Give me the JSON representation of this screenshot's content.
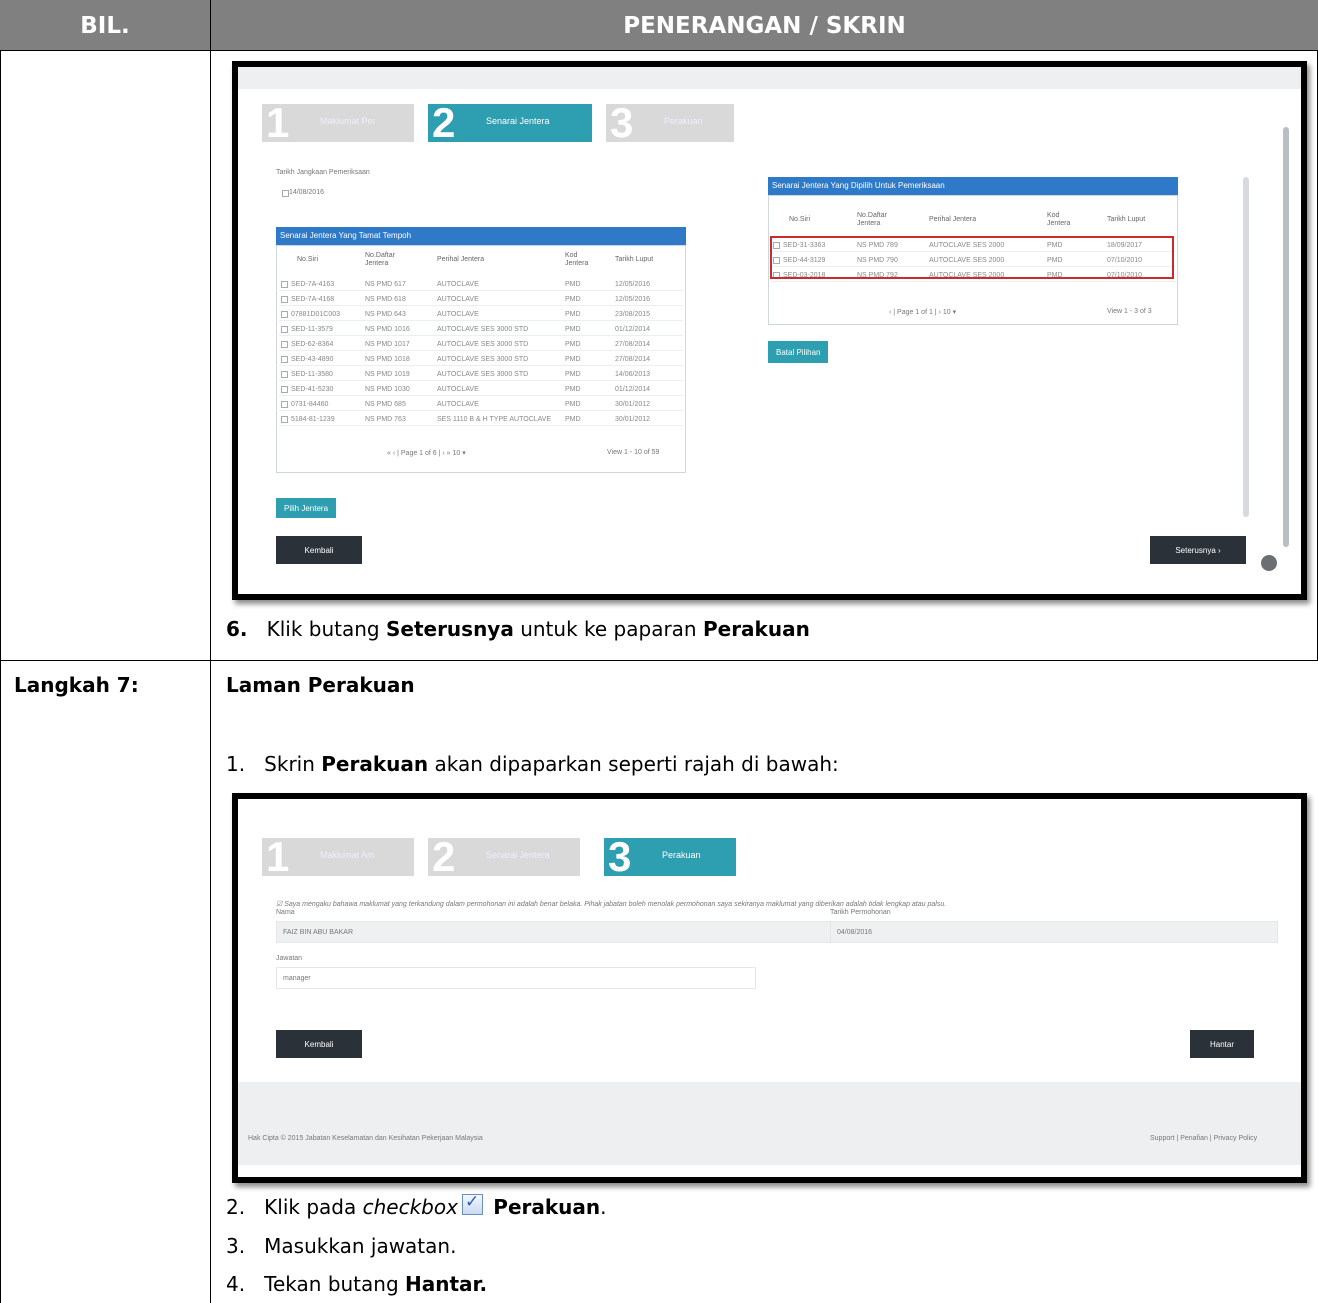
{
  "table": {
    "col1_header": "BIL.",
    "col2_header": "PENERANGAN / SKRIN"
  },
  "row1": {
    "instruction_num": "6.",
    "instruction_pre": "Klik butang ",
    "instruction_bold1": "Seterusnya",
    "instruction_mid": " untuk ke paparan ",
    "instruction_bold2": "Perakuan"
  },
  "row2": {
    "step_label": "Langkah 7:",
    "section_title": "Laman Perakuan",
    "item1_num": "1.",
    "item1_pre": "Skrin ",
    "item1_bold": "Perakuan",
    "item1_post": " akan dipaparkan seperti rajah di bawah:",
    "item2_num": "2.",
    "item2_pre": "Klik pada ",
    "item2_italic": "checkbox",
    "item2_bold": "Perakuan",
    "item2_post": ".",
    "item3_num": "3.",
    "item3_text": "Masukkan jawatan.",
    "item4_num": "4.",
    "item4_pre": "Tekan butang ",
    "item4_bold": "Hantar."
  },
  "shot1": {
    "steps": [
      {
        "n": "1",
        "label": "Maklumat Per"
      },
      {
        "n": "2",
        "label": "Senarai Jentera"
      },
      {
        "n": "3",
        "label": "Perakuan"
      }
    ],
    "date_label": "Tarikh Jangkaan Pemeriksaan",
    "date_value": "14/08/2016",
    "left_title": "Senarai Jentera Yang Tamat Tempoh",
    "left_cols": [
      "No.Siri",
      "No.Daftar Jentera",
      "Perihal Jentera",
      "Kod Jentera",
      "Tarikh Luput"
    ],
    "left_rows": [
      [
        "SED-7A-4163",
        "NS PMD 617",
        "AUTOCLAVE",
        "PMD",
        "12/05/2016"
      ],
      [
        "SED-7A-4168",
        "NS PMD 618",
        "AUTOCLAVE",
        "PMD",
        "12/05/2016"
      ],
      [
        "07881D01C003",
        "NS PMD 643",
        "AUTOCLAVE",
        "PMD",
        "23/08/2015"
      ],
      [
        "SED-11-3579",
        "NS PMD 1016",
        "AUTOCLAVE SES 3000 STD",
        "PMD",
        "01/12/2014"
      ],
      [
        "SED-62-8364",
        "NS PMD 1017",
        "AUTOCLAVE SES 3000 STD",
        "PMD",
        "27/08/2014"
      ],
      [
        "SED-43-4890",
        "NS PMD 1018",
        "AUTOCLAVE SES 3000 STD",
        "PMD",
        "27/08/2014"
      ],
      [
        "SED-11-3580",
        "NS PMD 1019",
        "AUTOCLAVE SES 3000 STD",
        "PMD",
        "14/06/2013"
      ],
      [
        "SED-41-5230",
        "NS PMD 1030",
        "AUTOCLAVE",
        "PMD",
        "01/12/2014"
      ],
      [
        "0731-84460",
        "NS PMD 685",
        "AUTOCLAVE",
        "PMD",
        "30/01/2012"
      ],
      [
        "5184-81-1239",
        "NS PMD 763",
        "SES 1110 B & H TYPE AUTOCLAVE",
        "PMD",
        "30/01/2012"
      ]
    ],
    "left_pager": "Page 1 of 6",
    "left_view": "View 1 - 10 of 59",
    "pilih_btn": "Pilih Jentera",
    "kembali_btn": "Kembali",
    "right_title": "Senarai Jentera Yang Dipilih Untuk Pemeriksaan",
    "right_cols": [
      "No.Siri",
      "No.Daftar Jentera",
      "Perihal Jentera",
      "Kod Jentera",
      "Tarikh Luput"
    ],
    "right_rows": [
      [
        "SED-31-3363",
        "NS PMD 789",
        "AUTOCLAVE SES 2000",
        "PMD",
        "18/09/2017"
      ],
      [
        "SED-44-3129",
        "NS PMD 790",
        "AUTOCLAVE SES 2000",
        "PMD",
        "07/10/2010"
      ],
      [
        "SED-03-2018",
        "NS PMD 792",
        "AUTOCLAVE SES 2000",
        "PMD",
        "07/10/2010"
      ]
    ],
    "right_pager": "Page 1 of 1",
    "right_view": "View 1 - 3 of 3",
    "batal_btn": "Batal Pilihan",
    "seterusnya_btn": "Seterusnya"
  },
  "shot2": {
    "steps": [
      {
        "n": "1",
        "label": "Maklumat Am"
      },
      {
        "n": "2",
        "label": "Senarai Jentera"
      },
      {
        "n": "3",
        "label": "Perakuan"
      }
    ],
    "declaration": "Saya mengaku bahawa maklumat yang terkandung dalam permohonan ini adalah benar belaka. Pihak jabatan boleh menolak permohonan saya sekiranya maklumat yang diberikan adalah tidak lengkap atau palsu.",
    "nama_label": "Nama",
    "nama_value": "FAIZ BIN ABU BAKAR",
    "tarikh_label": "Tarikh Permohonan",
    "tarikh_value": "04/08/2016",
    "jawatan_label": "Jawatan",
    "jawatan_value": "manager",
    "kembali_btn": "Kembali",
    "hantar_btn": "Hantar",
    "footer_left": "Hak Cipta © 2015 Jabatan Keselamatan dan Kesihatan Pekerjaan Malaysia",
    "footer_right": "Support | Penafian | Privacy Policy"
  }
}
